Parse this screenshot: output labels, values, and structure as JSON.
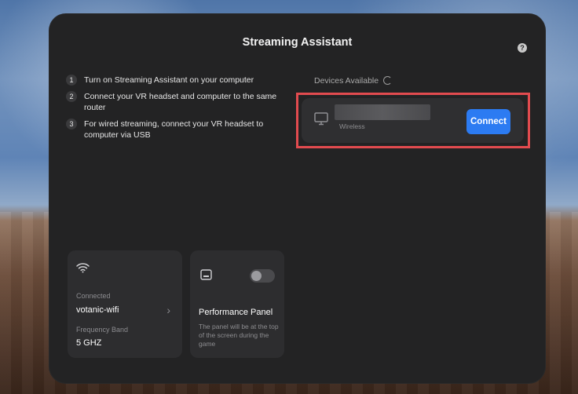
{
  "window": {
    "title": "Streaming Assistant",
    "help_icon": "question-mark-icon"
  },
  "steps": [
    {
      "num": "1",
      "text": "Turn on Streaming Assistant on your computer"
    },
    {
      "num": "2",
      "text": "Connect your VR headset and computer to the same router"
    },
    {
      "num": "3",
      "text": "For wired streaming, connect your VR headset to computer via USB"
    }
  ],
  "devices": {
    "label": "Devices Available",
    "items": [
      {
        "type": "Wireless",
        "button": "Connect"
      }
    ]
  },
  "wifi": {
    "connected_label": "Connected",
    "ssid": "votanic-wifi",
    "frequency_label": "Frequency Band",
    "frequency_value": "5 GHZ"
  },
  "performance": {
    "title": "Performance Panel",
    "description": "The panel will be at the top of the screen during the game",
    "enabled": false
  },
  "colors": {
    "panel_bg": "#232324",
    "card_bg": "#2d2d2f",
    "accent": "#2c7bf2",
    "highlight": "#e24b4f"
  }
}
